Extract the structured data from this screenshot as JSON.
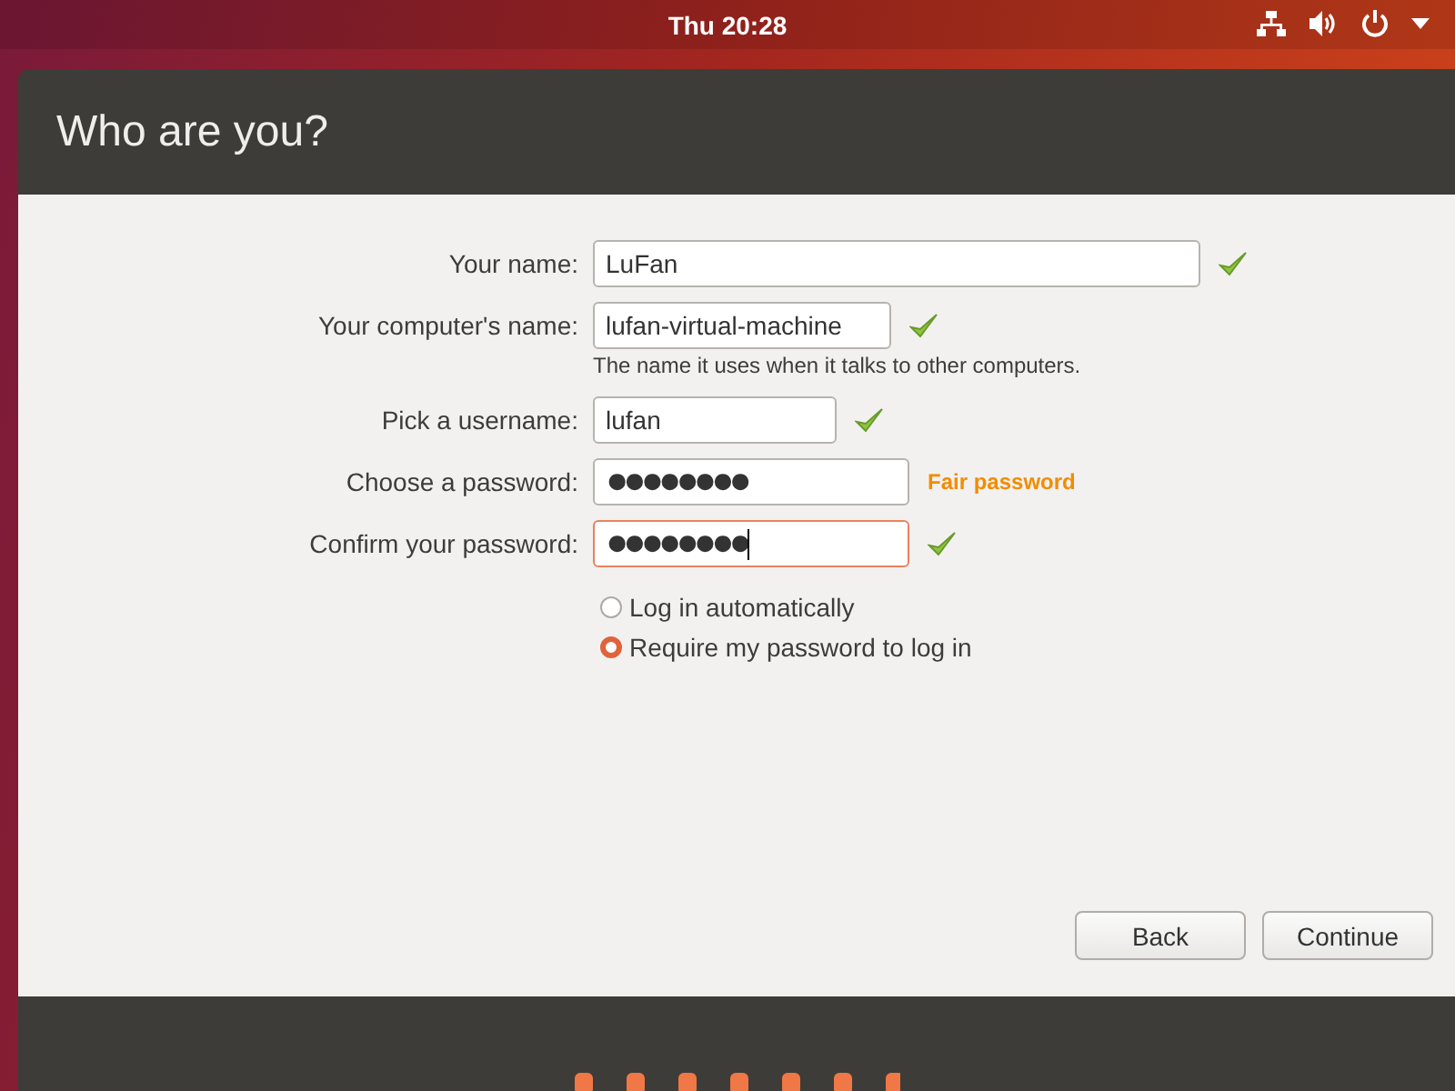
{
  "top_bar": {
    "clock": "Thu 20:28"
  },
  "window": {
    "title": "Who are you?"
  },
  "fields": [
    {
      "label": "Your name:",
      "value": "LuFan",
      "valid": true,
      "focused": false
    },
    {
      "label": "Your computer's name:",
      "value": "lufan-virtual-machine",
      "valid": true,
      "focused": false,
      "hint": "The name it uses when it talks to other computers."
    },
    {
      "label": "Pick a username:",
      "value": "lufan",
      "valid": true,
      "focused": false
    },
    {
      "label": "Choose a password:",
      "value": "●●●●●●●●",
      "valid": false,
      "focused": false,
      "strength": "Fair password"
    },
    {
      "label": "Confirm your password:",
      "value": "●●●●●●●●",
      "valid": true,
      "focused": true
    }
  ],
  "login_options": [
    {
      "label": "Log in automatically",
      "selected": false
    },
    {
      "label": "Require my password to log in",
      "selected": true
    }
  ],
  "buttons": [
    "Back",
    "Continue"
  ]
}
